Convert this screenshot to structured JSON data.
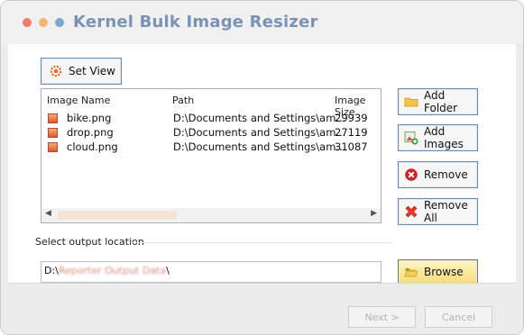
{
  "window": {
    "title": "Kernel Bulk Image Resizer",
    "traffic_lights": [
      "#f27b6a",
      "#f6b46f",
      "#7aa7cf"
    ]
  },
  "toolbar": {
    "set_view_label": "Set View",
    "set_view_icon": "gear-icon"
  },
  "image_list": {
    "columns": [
      "Image Name",
      "Path",
      "Image Size"
    ],
    "rows": [
      {
        "name": "bike.png",
        "path": "D:\\Documents and Settings\\am...",
        "size": "29939"
      },
      {
        "name": "drop.png",
        "path": "D:\\Documents and Settings\\am...",
        "size": "27119"
      },
      {
        "name": "cloud.png",
        "path": "D:\\Documents and Settings\\am...",
        "size": "31087"
      }
    ],
    "scroll_left": "◀",
    "scroll_right": "▶"
  },
  "actions": {
    "add_folder": "Add Folder",
    "add_images": "Add Images",
    "remove": "Remove",
    "remove_all": "Remove All"
  },
  "output": {
    "label": "Select output location",
    "path_prefix": "D:\\",
    "path_obscured": "Reporter Output Data",
    "path_suffix": "\\",
    "browse_label": "Browse"
  },
  "footer": {
    "next_label": "Next >",
    "cancel_label": "Cancel"
  }
}
